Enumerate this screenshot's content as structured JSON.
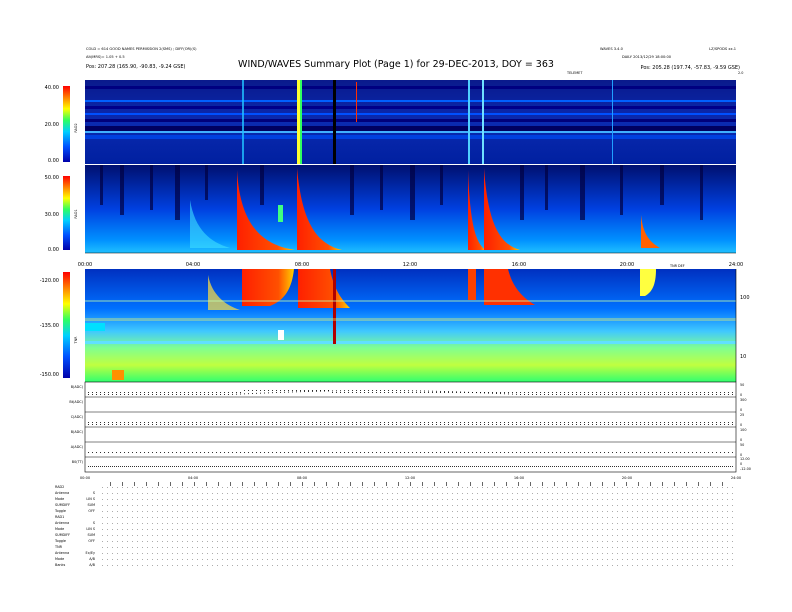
{
  "header": {
    "title": "WIND/WAVES Summary Plot (Page 1) for 29-DEC-2013, DOY = 363",
    "left_line1": "COLD = 614 GOOD NAMES PERMISSION 2(SMS) ; DIFF(OR)(S)",
    "left_line2": "Alt(MRS)= 1.05 + 0.5",
    "left_line3": "Pos:   207.28 (165.90, -90.83, -9.24 GSE)",
    "right_line1": "WAVES 3.4.0",
    "right_line2": "LZ/SPODS xx.1",
    "right_line3": "DAILY  2013/12/29 18:00:00",
    "right_line4": "Pos:   205.28 (197.74, -57.83, -9.59 GSE)",
    "tag1": "TELEMET",
    "tag2": "TNR DEF",
    "tag3": "2.0"
  },
  "chart_data": [
    {
      "type": "heatmap",
      "panel": "RAD2",
      "ylabel": "RAD2",
      "yticks": [
        "40.00",
        "20.00",
        "0.00"
      ],
      "ylim": [
        0,
        40
      ],
      "colorbar": true
    },
    {
      "type": "heatmap",
      "panel": "RAD1",
      "ylabel": "RAD1",
      "yticks": [
        "50.00",
        "30.00",
        "0.00"
      ],
      "ylim": [
        0,
        50
      ],
      "colorbar": true,
      "xticks": [
        "00:00",
        "04:00",
        "08:00",
        "12:00",
        "16:00",
        "20:00",
        "24:00"
      ]
    },
    {
      "type": "heatmap",
      "panel": "TNR",
      "ylabel": "TNR",
      "yticks": [
        "-120.00",
        "-135.00",
        "-150.00"
      ],
      "ylim": [
        -150,
        -120
      ],
      "right_ticks": [
        "100",
        "10"
      ],
      "colorbar": true
    },
    {
      "type": "line",
      "panels": [
        {
          "label": "B(ADC)",
          "right": [
            "50",
            "0"
          ]
        },
        {
          "label": "Bt(ADC)",
          "right": [
            "300",
            "0"
          ]
        },
        {
          "label": "C(ADC)",
          "right": [
            "25",
            "0"
          ]
        },
        {
          "label": "B(ADC)",
          "right": [
            "100",
            "0"
          ]
        },
        {
          "label": "A(ADC)",
          "right": [
            "50",
            "0"
          ]
        },
        {
          "label": "B0(TT)",
          "right": [
            "12.00",
            "0",
            "-12.00"
          ]
        }
      ],
      "xticks": [
        "00:00",
        "04:00",
        "08:00",
        "12:00",
        "16:00",
        "20:00",
        "24:00"
      ]
    }
  ],
  "mode_table": {
    "groups": [
      {
        "name": "RAD2",
        "rows": [
          [
            "Antenna",
            "S"
          ],
          [
            "Mode",
            "LIN S"
          ],
          [
            "SUMDIFF",
            "SUM"
          ],
          [
            "Toggle",
            "OFF"
          ]
        ]
      },
      {
        "name": "RAD1",
        "rows": [
          [
            "Antenna",
            "S"
          ],
          [
            "Mode",
            "LIN S"
          ],
          [
            "SUMDIFF",
            "SUM"
          ],
          [
            "Toggle",
            "OFF"
          ]
        ]
      },
      {
        "name": "TNR",
        "rows": [
          [
            "Antenna",
            "Ex/Ey"
          ],
          [
            "Mode",
            "A/B"
          ],
          [
            "Banks",
            "A/B"
          ]
        ]
      }
    ]
  }
}
